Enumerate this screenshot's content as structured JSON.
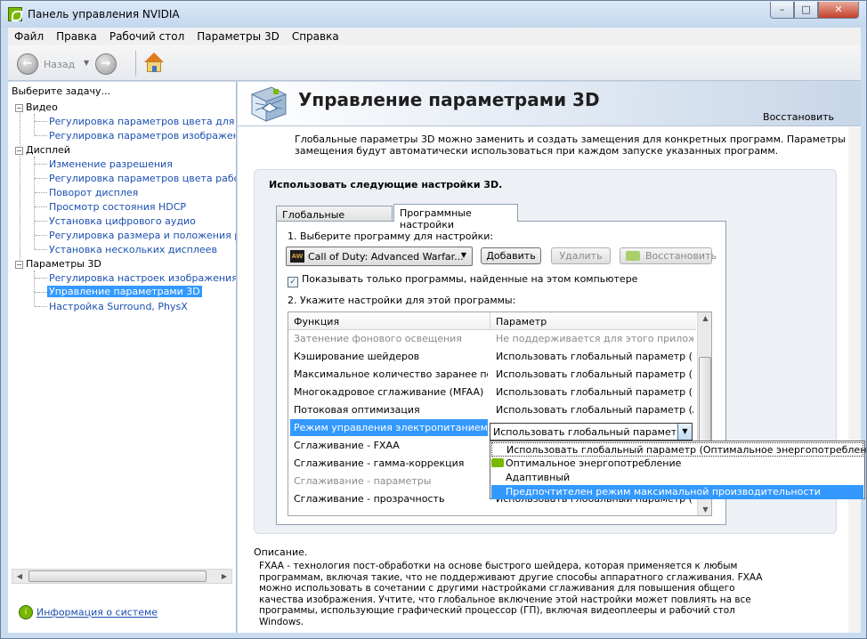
{
  "window": {
    "title": "Панель управления NVIDIA",
    "controls": {
      "minimize": "–",
      "maximize": "□",
      "close": "✕"
    }
  },
  "menu": [
    "Файл",
    "Правка",
    "Рабочий стол",
    "Параметры 3D",
    "Справка"
  ],
  "toolbar": {
    "back_label": "Назад",
    "back_icon": "←",
    "forward_icon": "→",
    "dropdown_icon": "▼"
  },
  "left_panel": {
    "header": "Выберите задачу...",
    "tree": [
      {
        "label": "Видео",
        "expander": "−",
        "children": [
          "Регулировка параметров цвета для вид",
          "Регулировка параметров изображения д"
        ]
      },
      {
        "label": "Дисплей",
        "expander": "−",
        "children": [
          "Изменение разрешения",
          "Регулировка параметров цвета рабочег",
          "Поворот дисплея",
          "Просмотр состояния HDCP",
          "Установка цифрового аудио",
          "Регулировка размера и положения рабо",
          "Установка нескольких дисплеев"
        ]
      },
      {
        "label": "Параметры 3D",
        "expander": "−",
        "children": [
          "Регулировка настроек изображения с пр",
          "Управление параметрами 3D",
          "Настройка Surround, PhysX"
        ]
      }
    ],
    "selected": "Управление параметрами 3D",
    "scroll_left": "◀",
    "scroll_right": "▶",
    "system_info": "Информация о системе"
  },
  "page": {
    "title": "Управление параметрами 3D",
    "restore": "Восстановить",
    "description": "Глобальные параметры 3D можно заменить и создать замещения для конкретных программ. Параметры замещения будут автоматически использоваться при каждом запуске указанных программ.",
    "group_title": "Использовать следующие настройки 3D.",
    "tabs": [
      "Глобальные параметры",
      "Программные настройки"
    ],
    "step1": "1. Выберите программу для настройки:",
    "program": {
      "icon_text": "AW",
      "value": "Call of Duty: Advanced Warfar...",
      "arrow": "▼"
    },
    "buttons": {
      "add": "Добавить",
      "delete": "Удалить",
      "restore": "Восстановить"
    },
    "checkbox": {
      "label": "Показывать только программы, найденные на этом компьютере",
      "checked": true,
      "mark": "✓"
    },
    "step2": "2. Укажите настройки для этой программы:",
    "grid": {
      "headers": [
        "Функция",
        "Параметр"
      ],
      "rows": [
        {
          "feature": "Затенение фонового освещения",
          "value": "Не поддерживается для этого приложе...",
          "dim": true
        },
        {
          "feature": "Кэширование шейдеров",
          "value": "Использовать глобальный параметр (В..."
        },
        {
          "feature": "Максимальное количество заранее под...",
          "value": "Использовать глобальный параметр (И..."
        },
        {
          "feature": "Многокадровое сглаживание (MFAA)",
          "value": "Использовать глобальный параметр (В..."
        },
        {
          "feature": "Потоковая оптимизация",
          "value": "Использовать глобальный параметр (А..."
        },
        {
          "feature": "Режим управления электропитанием",
          "value": "Использовать глобальный параметр (Оп",
          "selected": true
        },
        {
          "feature": "Сглаживание - FXAA",
          "value": ""
        },
        {
          "feature": "Сглаживание - гамма-коррекция",
          "value": ""
        },
        {
          "feature": "Сглаживание - параметры",
          "value": "",
          "dim": true
        },
        {
          "feature": "Сглаживание - прозрачность",
          "value": "Использовать глобальный параметр (В..."
        }
      ],
      "scroll_up": "▲",
      "scroll_down": "▼"
    },
    "dropdown": {
      "current": "Использовать глобальный параметр (Оп",
      "arrow": "▼",
      "options": [
        "Использовать глобальный параметр (Оптимальное энергопотребление)",
        "Оптимальное энергопотребление",
        "Адаптивный",
        "Предпочтителен режим максимальной производительности"
      ],
      "highlighted_index": 3
    },
    "desc_title": "Описание.",
    "desc_body": "FXAA - технология пост-обработки на основе быстрого шейдера, которая применяется к любым программам, включая такие, что не поддерживают другие способы аппаратного сглаживания. FXAA можно использовать в сочетании с другими настройками сглаживания для повышения общего качества изображения. Учтите, что глобальное включение этой настройки может повлиять на все программы, использующие графический процессор (ГП), включая видеоплееры и рабочий стол Windows."
  }
}
